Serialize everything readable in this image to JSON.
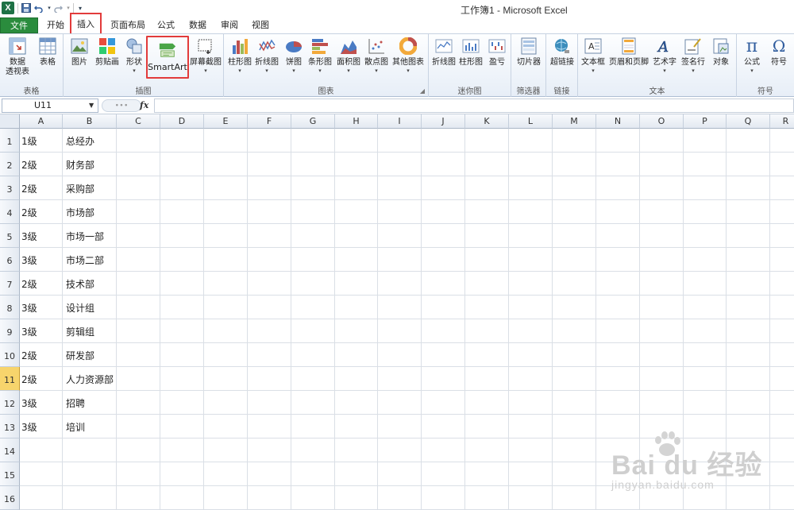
{
  "window": {
    "title": "工作簿1 - Microsoft Excel"
  },
  "qat": {
    "sep_glyph": "▾"
  },
  "tabs": [
    {
      "label": "文件"
    },
    {
      "label": "开始"
    },
    {
      "label": "插入"
    },
    {
      "label": "页面布局"
    },
    {
      "label": "公式"
    },
    {
      "label": "数据"
    },
    {
      "label": "审阅"
    },
    {
      "label": "视图"
    }
  ],
  "ribbon": {
    "groups": {
      "tables": "表格",
      "illustrations": "插图",
      "charts": "图表",
      "sparklines": "迷你图",
      "filter": "筛选器",
      "links": "链接",
      "text": "文本",
      "symbols": "符号"
    },
    "buttons": {
      "pivot_line1": "数据",
      "pivot_line2": "透视表",
      "table": "表格",
      "picture": "图片",
      "clipart": "剪贴画",
      "shapes": "形状",
      "smartart": "SmartArt",
      "screenshot": "屏幕截图",
      "column_chart": "柱形图",
      "line_chart": "折线图",
      "pie_chart": "饼图",
      "bar_chart": "条形图",
      "area_chart": "面积图",
      "scatter_chart": "散点图",
      "other_charts": "其他图表",
      "spark_line": "折线图",
      "spark_column": "柱形图",
      "spark_winloss": "盈亏",
      "slicer": "切片器",
      "hyperlink": "超链接",
      "textbox": "文本框",
      "header_footer": "页眉和页脚",
      "wordart": "艺术字",
      "signature": "签名行",
      "object": "对象",
      "equation": "公式",
      "symbol": "符号"
    }
  },
  "formula_bar": {
    "name_box": "U11",
    "fx": "fx",
    "value": ""
  },
  "columns": [
    "A",
    "B",
    "C",
    "D",
    "E",
    "F",
    "G",
    "H",
    "I",
    "J",
    "K",
    "L",
    "M",
    "N",
    "O",
    "P",
    "Q",
    "R"
  ],
  "rows": [
    "1",
    "2",
    "3",
    "4",
    "5",
    "6",
    "7",
    "8",
    "9",
    "10",
    "11",
    "12",
    "13",
    "14",
    "15",
    "16"
  ],
  "selected_row": "11",
  "cells": [
    {
      "a": "1级",
      "b": "总经办"
    },
    {
      "a": "2级",
      "b": "财务部"
    },
    {
      "a": "2级",
      "b": "采购部"
    },
    {
      "a": "2级",
      "b": "市场部"
    },
    {
      "a": "3级",
      "b": "市场一部"
    },
    {
      "a": "3级",
      "b": "市场二部"
    },
    {
      "a": "2级",
      "b": "技术部"
    },
    {
      "a": "3级",
      "b": "设计组"
    },
    {
      "a": "3级",
      "b": "剪辑组"
    },
    {
      "a": "2级",
      "b": "研发部"
    },
    {
      "a": "2级",
      "b": "人力资源部"
    },
    {
      "a": "3级",
      "b": "招聘"
    },
    {
      "a": "3级",
      "b": "培训"
    }
  ],
  "watermark": {
    "main": "Bai du 经验",
    "sub": "jingyan.baidu.com"
  },
  "colors": {
    "file_tab": "#2a8c3d",
    "highlight": "#e23b3b",
    "selected_row": "#f7d46c"
  }
}
